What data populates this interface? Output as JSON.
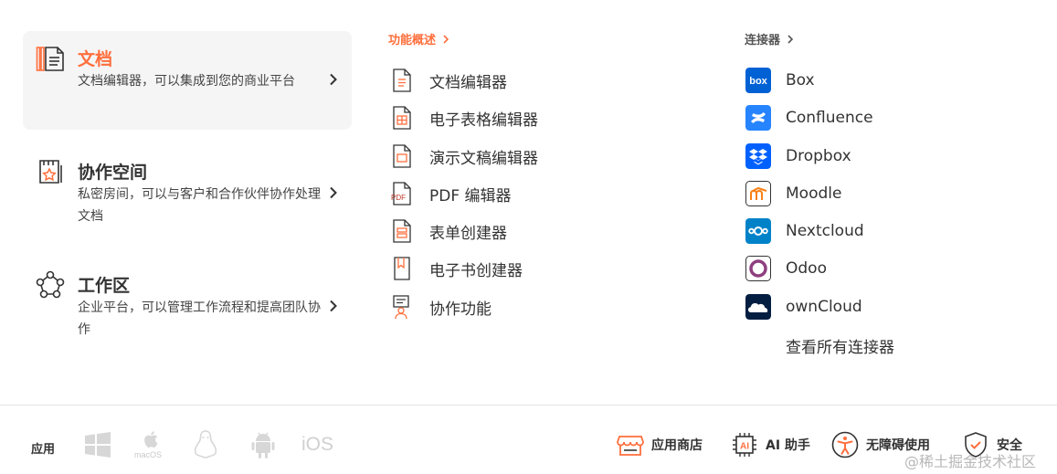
{
  "products": [
    {
      "title": "文档",
      "desc": "文档编辑器，可以集成到您的商业平台"
    },
    {
      "title": "协作空间",
      "desc": "私密房间，可以与客户和合作伙伴协作处理文档"
    },
    {
      "title": "工作区",
      "desc": "企业平台，可以管理工作流程和提高团队协作"
    }
  ],
  "features": {
    "header": "功能概述",
    "items": [
      {
        "label": "文档编辑器",
        "icon": "document-icon"
      },
      {
        "label": "电子表格编辑器",
        "icon": "spreadsheet-icon"
      },
      {
        "label": "演示文稿编辑器",
        "icon": "presentation-icon"
      },
      {
        "label": "PDF 编辑器",
        "icon": "pdf-icon"
      },
      {
        "label": "表单创建器",
        "icon": "form-icon"
      },
      {
        "label": "电子书创建器",
        "icon": "ebook-icon"
      },
      {
        "label": "协作功能",
        "icon": "collaboration-icon"
      }
    ]
  },
  "connectors": {
    "header": "连接器",
    "items": [
      {
        "label": "Box",
        "icon": "box-logo"
      },
      {
        "label": "Confluence",
        "icon": "confluence-logo"
      },
      {
        "label": "Dropbox",
        "icon": "dropbox-logo"
      },
      {
        "label": "Moodle",
        "icon": "moodle-logo"
      },
      {
        "label": "Nextcloud",
        "icon": "nextcloud-logo"
      },
      {
        "label": "Odoo",
        "icon": "odoo-logo"
      },
      {
        "label": "ownCloud",
        "icon": "owncloud-logo"
      }
    ],
    "all_label": "查看所有连接器"
  },
  "footer": {
    "apps_label": "应用",
    "os": [
      {
        "icon": "windows-icon"
      },
      {
        "icon": "macos-icon",
        "text": "macOS"
      },
      {
        "icon": "linux-icon"
      },
      {
        "icon": "android-icon"
      },
      {
        "icon": "ios-icon",
        "text": "iOS"
      }
    ],
    "links": [
      {
        "label": "应用商店",
        "icon": "store-icon"
      },
      {
        "label": "AI 助手",
        "icon": "ai-chip-icon"
      },
      {
        "label": "无障碍使用",
        "icon": "accessibility-icon"
      },
      {
        "label": "安全",
        "icon": "shield-icon"
      }
    ]
  },
  "watermark": "@稀土掘金技术社区",
  "colors": {
    "accent": "#ff6f3d",
    "section_header": "#ff6f3d",
    "connector_header": "#555555",
    "active_bg": "#f5f5f5"
  }
}
